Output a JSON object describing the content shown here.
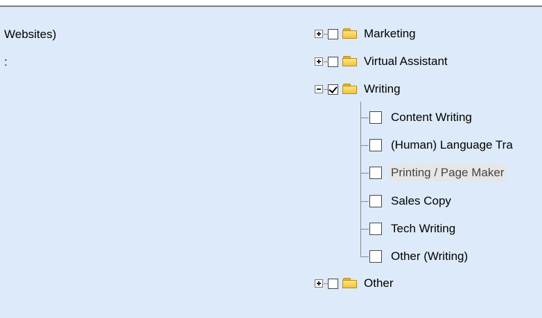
{
  "left": {
    "line1": "Websites)",
    "line2": ":"
  },
  "tree": {
    "marketing": {
      "label": "Marketing",
      "checked": false,
      "expanded": false
    },
    "virtual_assistant": {
      "label": "Virtual Assistant",
      "checked": false,
      "expanded": false
    },
    "writing": {
      "label": "Writing",
      "checked": true,
      "expanded": true,
      "children": [
        {
          "label": "Content Writing",
          "checked": false
        },
        {
          "label": "(Human) Language Tra",
          "checked": false
        },
        {
          "label": "Printing / Page Maker",
          "checked": false,
          "highlighted": true
        },
        {
          "label": "Sales Copy",
          "checked": false
        },
        {
          "label": "Tech Writing",
          "checked": false
        },
        {
          "label": "Other (Writing)",
          "checked": false
        }
      ]
    },
    "other": {
      "label": "Other",
      "checked": false,
      "expanded": false
    }
  },
  "icons": {
    "expand": "plus-box-icon",
    "collapse": "minus-box-icon",
    "folder": "folder-icon"
  }
}
